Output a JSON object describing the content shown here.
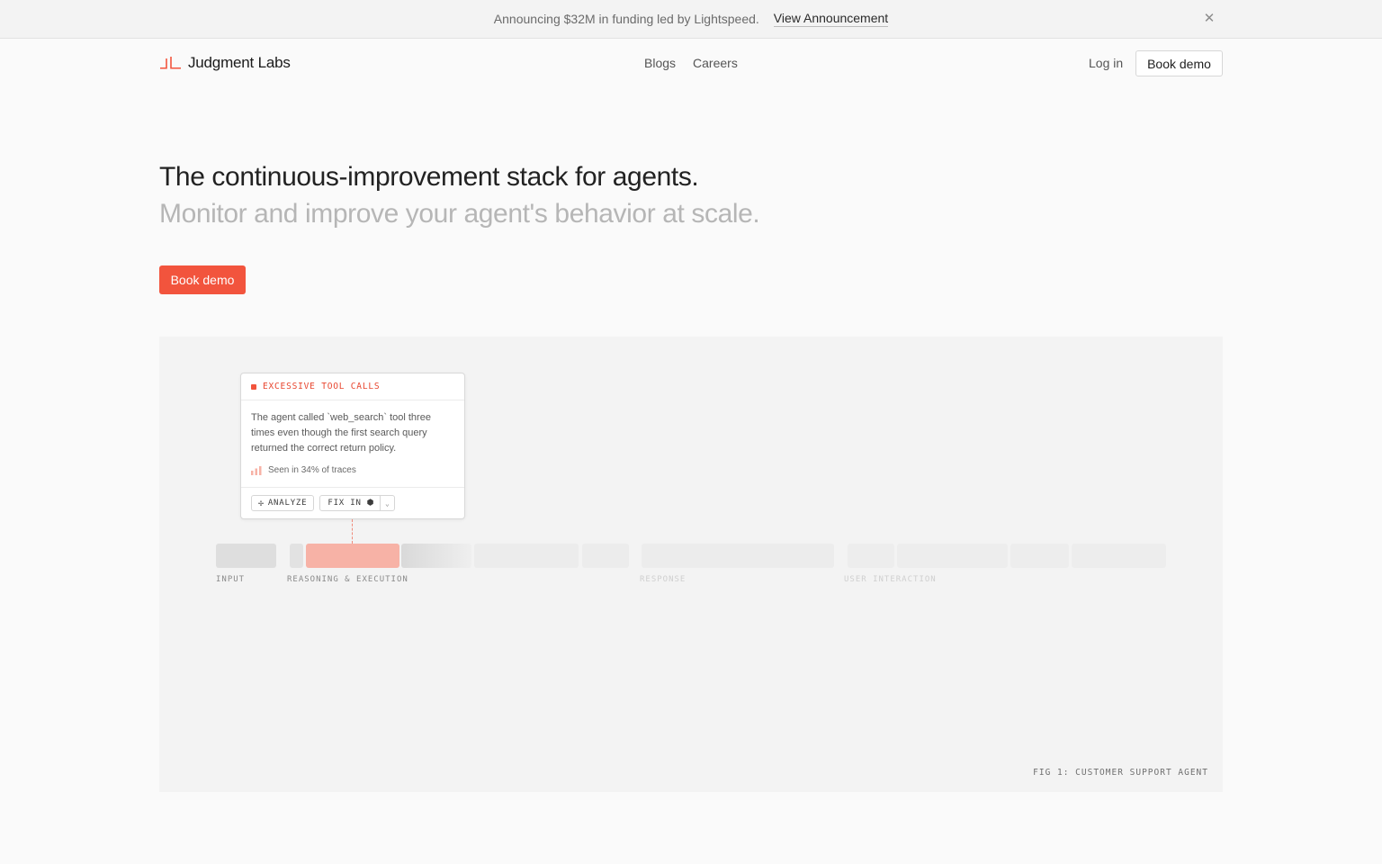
{
  "announcement": {
    "text": "Announcing $32M in funding led by Lightspeed.",
    "link": "View Announcement",
    "close_icon": "close-icon"
  },
  "nav": {
    "brand": "Judgment Labs",
    "links": [
      "Blogs",
      "Careers"
    ],
    "login": "Log in",
    "cta": "Book demo"
  },
  "hero": {
    "title": "The continuous-improvement stack for agents.",
    "subtitle": "Monitor and improve your agent's behavior at scale.",
    "cta": "Book demo"
  },
  "figure": {
    "card": {
      "tag": "EXCESSIVE TOOL CALLS",
      "description": "The agent called `web_search` tool three times even though the first search query returned the correct return policy.",
      "stat": "Seen in 34% of traces",
      "analyze_label": "ANALYZE",
      "fix_label": "FIX IN"
    },
    "stages": [
      "INPUT",
      "REASONING & EXECUTION",
      "RESPONSE",
      "USER INTERACTION"
    ],
    "caption": "FIG 1: CUSTOMER SUPPORT AGENT"
  },
  "colors": {
    "accent": "#f2543d",
    "highlight_segment": "#f7b2a6",
    "background": "#fafafa"
  }
}
